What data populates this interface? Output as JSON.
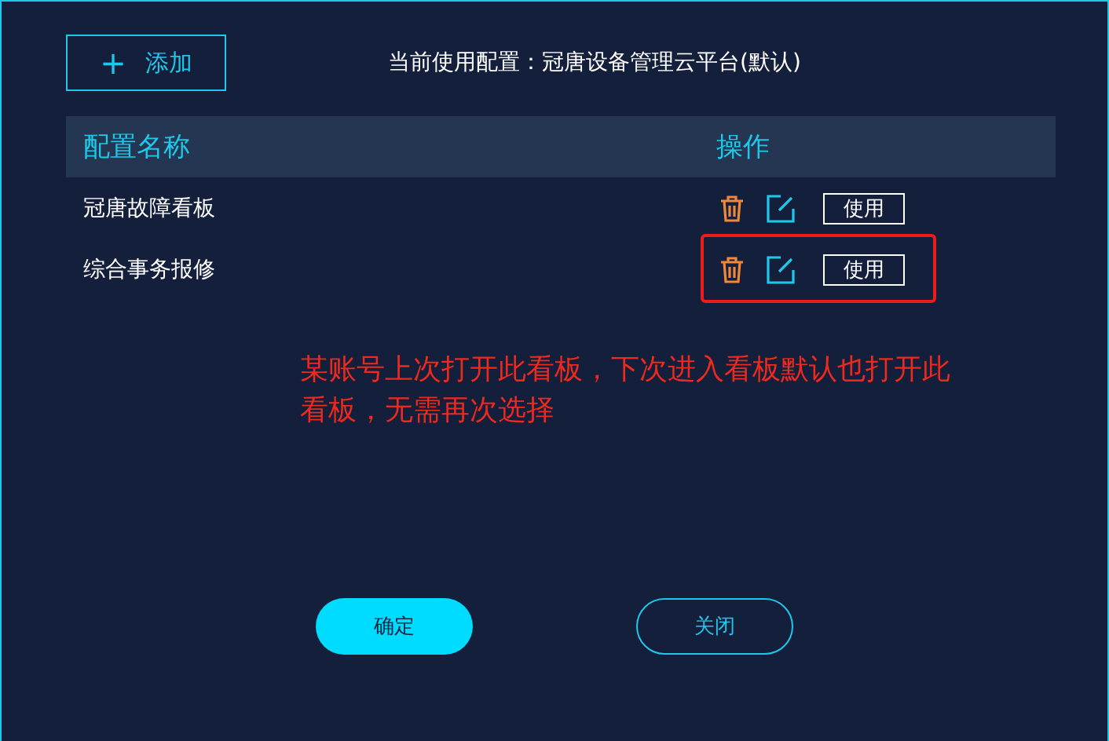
{
  "add_button": {
    "icon": "+",
    "label": "添加"
  },
  "current_config": "当前使用配置：冠唐设备管理云平台(默认)",
  "table": {
    "columns": [
      "配置名称",
      "操作"
    ],
    "rows": [
      {
        "name": "冠唐故障看板",
        "use_label": "使用",
        "highlighted": false
      },
      {
        "name": "综合事务报修",
        "use_label": "使用",
        "highlighted": true
      }
    ]
  },
  "annotation": "某账号上次打开此看板，下次进入看板默认也打开此看板，无需再次选择",
  "buttons": [
    {
      "label": "确定",
      "kind": "primary"
    },
    {
      "label": "关闭",
      "kind": "secondary"
    }
  ]
}
